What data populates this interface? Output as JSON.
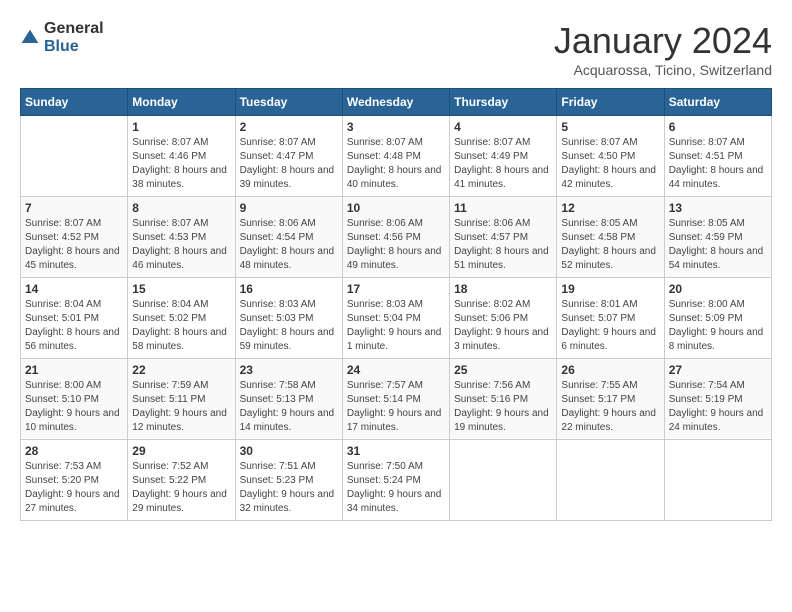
{
  "logo": {
    "general": "General",
    "blue": "Blue"
  },
  "title": "January 2024",
  "subtitle": "Acquarossa, Ticino, Switzerland",
  "weekdays": [
    "Sunday",
    "Monday",
    "Tuesday",
    "Wednesday",
    "Thursday",
    "Friday",
    "Saturday"
  ],
  "weeks": [
    [
      {
        "day": "",
        "sunrise": "",
        "sunset": "",
        "daylight": ""
      },
      {
        "day": "1",
        "sunrise": "Sunrise: 8:07 AM",
        "sunset": "Sunset: 4:46 PM",
        "daylight": "Daylight: 8 hours and 38 minutes."
      },
      {
        "day": "2",
        "sunrise": "Sunrise: 8:07 AM",
        "sunset": "Sunset: 4:47 PM",
        "daylight": "Daylight: 8 hours and 39 minutes."
      },
      {
        "day": "3",
        "sunrise": "Sunrise: 8:07 AM",
        "sunset": "Sunset: 4:48 PM",
        "daylight": "Daylight: 8 hours and 40 minutes."
      },
      {
        "day": "4",
        "sunrise": "Sunrise: 8:07 AM",
        "sunset": "Sunset: 4:49 PM",
        "daylight": "Daylight: 8 hours and 41 minutes."
      },
      {
        "day": "5",
        "sunrise": "Sunrise: 8:07 AM",
        "sunset": "Sunset: 4:50 PM",
        "daylight": "Daylight: 8 hours and 42 minutes."
      },
      {
        "day": "6",
        "sunrise": "Sunrise: 8:07 AM",
        "sunset": "Sunset: 4:51 PM",
        "daylight": "Daylight: 8 hours and 44 minutes."
      }
    ],
    [
      {
        "day": "7",
        "sunrise": "Sunrise: 8:07 AM",
        "sunset": "Sunset: 4:52 PM",
        "daylight": "Daylight: 8 hours and 45 minutes."
      },
      {
        "day": "8",
        "sunrise": "Sunrise: 8:07 AM",
        "sunset": "Sunset: 4:53 PM",
        "daylight": "Daylight: 8 hours and 46 minutes."
      },
      {
        "day": "9",
        "sunrise": "Sunrise: 8:06 AM",
        "sunset": "Sunset: 4:54 PM",
        "daylight": "Daylight: 8 hours and 48 minutes."
      },
      {
        "day": "10",
        "sunrise": "Sunrise: 8:06 AM",
        "sunset": "Sunset: 4:56 PM",
        "daylight": "Daylight: 8 hours and 49 minutes."
      },
      {
        "day": "11",
        "sunrise": "Sunrise: 8:06 AM",
        "sunset": "Sunset: 4:57 PM",
        "daylight": "Daylight: 8 hours and 51 minutes."
      },
      {
        "day": "12",
        "sunrise": "Sunrise: 8:05 AM",
        "sunset": "Sunset: 4:58 PM",
        "daylight": "Daylight: 8 hours and 52 minutes."
      },
      {
        "day": "13",
        "sunrise": "Sunrise: 8:05 AM",
        "sunset": "Sunset: 4:59 PM",
        "daylight": "Daylight: 8 hours and 54 minutes."
      }
    ],
    [
      {
        "day": "14",
        "sunrise": "Sunrise: 8:04 AM",
        "sunset": "Sunset: 5:01 PM",
        "daylight": "Daylight: 8 hours and 56 minutes."
      },
      {
        "day": "15",
        "sunrise": "Sunrise: 8:04 AM",
        "sunset": "Sunset: 5:02 PM",
        "daylight": "Daylight: 8 hours and 58 minutes."
      },
      {
        "day": "16",
        "sunrise": "Sunrise: 8:03 AM",
        "sunset": "Sunset: 5:03 PM",
        "daylight": "Daylight: 8 hours and 59 minutes."
      },
      {
        "day": "17",
        "sunrise": "Sunrise: 8:03 AM",
        "sunset": "Sunset: 5:04 PM",
        "daylight": "Daylight: 9 hours and 1 minute."
      },
      {
        "day": "18",
        "sunrise": "Sunrise: 8:02 AM",
        "sunset": "Sunset: 5:06 PM",
        "daylight": "Daylight: 9 hours and 3 minutes."
      },
      {
        "day": "19",
        "sunrise": "Sunrise: 8:01 AM",
        "sunset": "Sunset: 5:07 PM",
        "daylight": "Daylight: 9 hours and 6 minutes."
      },
      {
        "day": "20",
        "sunrise": "Sunrise: 8:00 AM",
        "sunset": "Sunset: 5:09 PM",
        "daylight": "Daylight: 9 hours and 8 minutes."
      }
    ],
    [
      {
        "day": "21",
        "sunrise": "Sunrise: 8:00 AM",
        "sunset": "Sunset: 5:10 PM",
        "daylight": "Daylight: 9 hours and 10 minutes."
      },
      {
        "day": "22",
        "sunrise": "Sunrise: 7:59 AM",
        "sunset": "Sunset: 5:11 PM",
        "daylight": "Daylight: 9 hours and 12 minutes."
      },
      {
        "day": "23",
        "sunrise": "Sunrise: 7:58 AM",
        "sunset": "Sunset: 5:13 PM",
        "daylight": "Daylight: 9 hours and 14 minutes."
      },
      {
        "day": "24",
        "sunrise": "Sunrise: 7:57 AM",
        "sunset": "Sunset: 5:14 PM",
        "daylight": "Daylight: 9 hours and 17 minutes."
      },
      {
        "day": "25",
        "sunrise": "Sunrise: 7:56 AM",
        "sunset": "Sunset: 5:16 PM",
        "daylight": "Daylight: 9 hours and 19 minutes."
      },
      {
        "day": "26",
        "sunrise": "Sunrise: 7:55 AM",
        "sunset": "Sunset: 5:17 PM",
        "daylight": "Daylight: 9 hours and 22 minutes."
      },
      {
        "day": "27",
        "sunrise": "Sunrise: 7:54 AM",
        "sunset": "Sunset: 5:19 PM",
        "daylight": "Daylight: 9 hours and 24 minutes."
      }
    ],
    [
      {
        "day": "28",
        "sunrise": "Sunrise: 7:53 AM",
        "sunset": "Sunset: 5:20 PM",
        "daylight": "Daylight: 9 hours and 27 minutes."
      },
      {
        "day": "29",
        "sunrise": "Sunrise: 7:52 AM",
        "sunset": "Sunset: 5:22 PM",
        "daylight": "Daylight: 9 hours and 29 minutes."
      },
      {
        "day": "30",
        "sunrise": "Sunrise: 7:51 AM",
        "sunset": "Sunset: 5:23 PM",
        "daylight": "Daylight: 9 hours and 32 minutes."
      },
      {
        "day": "31",
        "sunrise": "Sunrise: 7:50 AM",
        "sunset": "Sunset: 5:24 PM",
        "daylight": "Daylight: 9 hours and 34 minutes."
      },
      {
        "day": "",
        "sunrise": "",
        "sunset": "",
        "daylight": ""
      },
      {
        "day": "",
        "sunrise": "",
        "sunset": "",
        "daylight": ""
      },
      {
        "day": "",
        "sunrise": "",
        "sunset": "",
        "daylight": ""
      }
    ]
  ]
}
